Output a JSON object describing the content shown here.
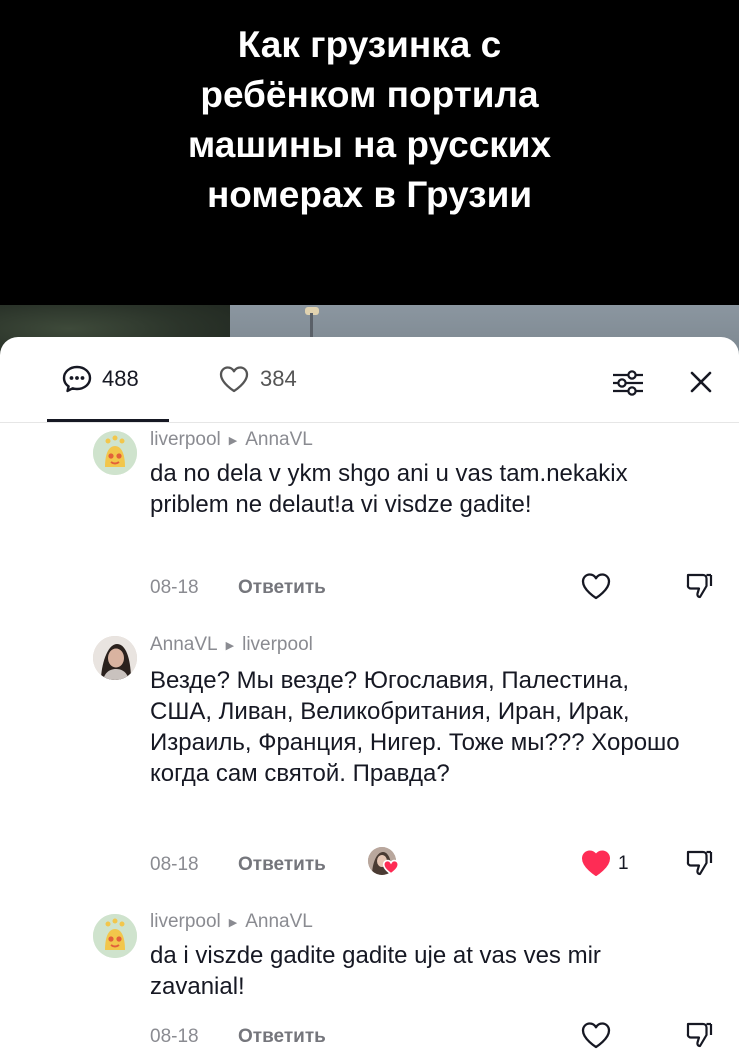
{
  "video": {
    "title_lines": [
      "Как грузинка с",
      "ребёнком портила",
      "машины на русских",
      "номерах в Грузии"
    ]
  },
  "sheet": {
    "tabs": [
      {
        "icon": "comment-bubble-icon",
        "count": "488"
      },
      {
        "icon": "heart-outline-icon",
        "count": "384"
      }
    ],
    "filter_icon": "sliders-icon",
    "close_icon": "close-icon"
  },
  "comments": [
    {
      "author": "liverpool",
      "reply_to": "AnnaVL",
      "avatar_icon": "alien-avatar",
      "text": "da no dela v ykm shgo ani u vas tam.nekakix priblem ne delaut!a vi visdze gadite!",
      "date": "08-18",
      "reply_label": "Ответить",
      "liked": false
    },
    {
      "author": "AnnaVL",
      "reply_to": "liverpool",
      "avatar_icon": "user-photo-avatar",
      "text": "Везде? Мы везде? Югославия, Палестина, США, Ливан, Великобритания, Иран, Ирак, Израиль, Франция, Нигер. Тоже мы??? Хорошо когда сам святой. Правда?",
      "date": "08-18",
      "reply_label": "Ответить",
      "liked": true,
      "like_count": "1",
      "creator_liked": true
    },
    {
      "author": "liverpool",
      "reply_to": "AnnaVL",
      "avatar_icon": "alien-avatar",
      "text": "da i viszde gadite gadite uje at vas ves mir zavanial!",
      "date": "08-18",
      "reply_label": "Ответить",
      "liked": false
    }
  ],
  "colors": {
    "like_red": "#fe2c55",
    "text_primary": "#161823",
    "text_secondary": "#8a8b91"
  }
}
